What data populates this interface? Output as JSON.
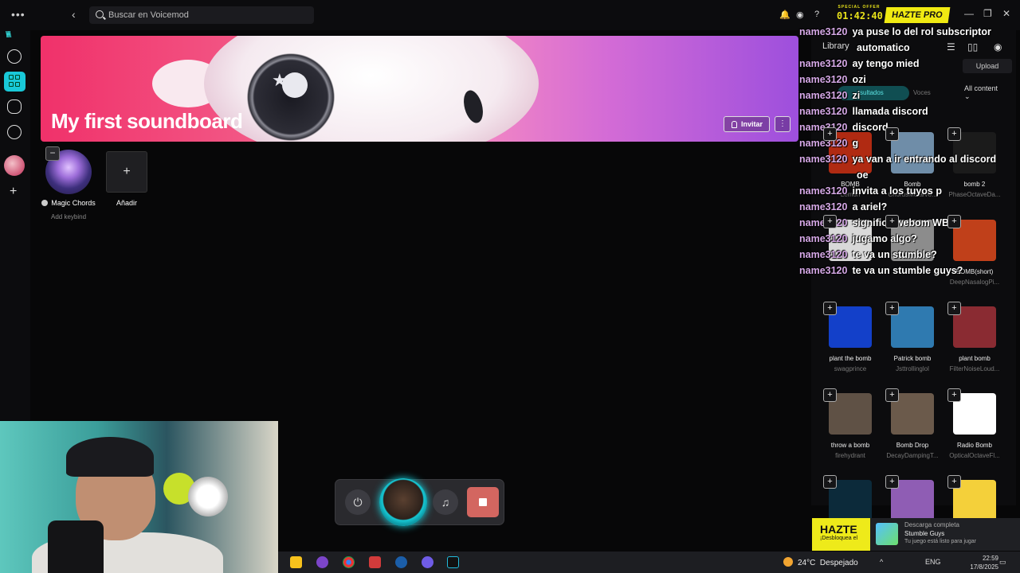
{
  "search": {
    "placeholder": "Buscar en Voicemod"
  },
  "topbar": {
    "offer_label": "SPECIAL OFFER",
    "timer": "01:42:40",
    "pro_button": "HAZTE PRO"
  },
  "banner": {
    "title": "My first soundboard",
    "invite_label": "Invitar"
  },
  "board": {
    "sounds": [
      {
        "label": "Magic Chords",
        "keybind": "Add keybind"
      }
    ],
    "add_label": "Añadir"
  },
  "library": {
    "title": "Library",
    "upload_label": "Upload",
    "filter_label": "sultados",
    "voces_label": "Voces",
    "all_content_label": "All content",
    "items": [
      {
        "title": "BOMB",
        "author": "Lemon",
        "color": "#b02a12"
      },
      {
        "title": "Bomb",
        "author": "ChorusMetalVo...",
        "color": "#6f8da8"
      },
      {
        "title": "bomb 2",
        "author": "PhaseOctaveDa...",
        "color": "#1b1b1b"
      },
      {
        "title": "",
        "author": "",
        "color": "#d9d9d9"
      },
      {
        "title": "",
        "author": "",
        "color": "#8c8c8c"
      },
      {
        "title": "BOMB(short)",
        "author": "DeepNasalogPi...",
        "color": "#c0401a"
      },
      {
        "title": "plant the bomb",
        "author": "swagprince",
        "color": "#1340c9"
      },
      {
        "title": "Patrick bomb",
        "author": "Jsttrollinglol",
        "color": "#2f7ab0"
      },
      {
        "title": "plant bomb",
        "author": "FilterNoiseLoud...",
        "color": "#8a2b32"
      },
      {
        "title": "throw a bomb",
        "author": "firehydrant",
        "color": "#5f5145"
      },
      {
        "title": "Bomb Drop",
        "author": "DecayDampingT...",
        "color": "#6b5a4b"
      },
      {
        "title": "Radio Bomb",
        "author": "OpticalOctaveFl...",
        "color": "#ffffff"
      },
      {
        "title": "",
        "author": "",
        "color": "#0c2a3a"
      },
      {
        "title": "",
        "author": "",
        "color": "#8f5db4"
      },
      {
        "title": "",
        "author": "",
        "color": "#f4d03a"
      }
    ]
  },
  "chat": [
    {
      "user": "name3120",
      "msg": "ya puse lo del rol subscriptor"
    },
    {
      "user": "",
      "msg": "automatico"
    },
    {
      "user": "name3120",
      "msg": "ay tengo mied"
    },
    {
      "user": "name3120",
      "msg": "ozi"
    },
    {
      "user": "name3120",
      "msg": "zi"
    },
    {
      "user": "name3120",
      "msg": "llamada discord"
    },
    {
      "user": "name3120",
      "msg": "discord"
    },
    {
      "user": "name3120",
      "msg": "g"
    },
    {
      "user": "name3120",
      "msg": "ya van a ir entrando al discord"
    },
    {
      "user": "",
      "msg": "oe"
    },
    {
      "user": "name3120",
      "msg": "invita a los tuyos p"
    },
    {
      "user": "name3120",
      "msg": "a ariel?"
    },
    {
      "user": "name3120",
      "msg": "significa webom WBM"
    },
    {
      "user": "name3120",
      "msg": "jugamo algo?"
    },
    {
      "user": "name3120",
      "msg": "te va un stumble?"
    },
    {
      "user": "name3120",
      "msg": "te va un stumble guys?"
    }
  ],
  "taskbar": {
    "temperature": "24°C",
    "weather": "Despejado",
    "lang": "ENG",
    "time": "22:59",
    "date": "17/8/2025"
  },
  "notification": {
    "ad_title": "HAZTE",
    "ad_sub": "¡Desbloquea el",
    "title": "Descarga completa",
    "game": "Stumble Guys",
    "body": "Tu juego está listo para jugar"
  }
}
